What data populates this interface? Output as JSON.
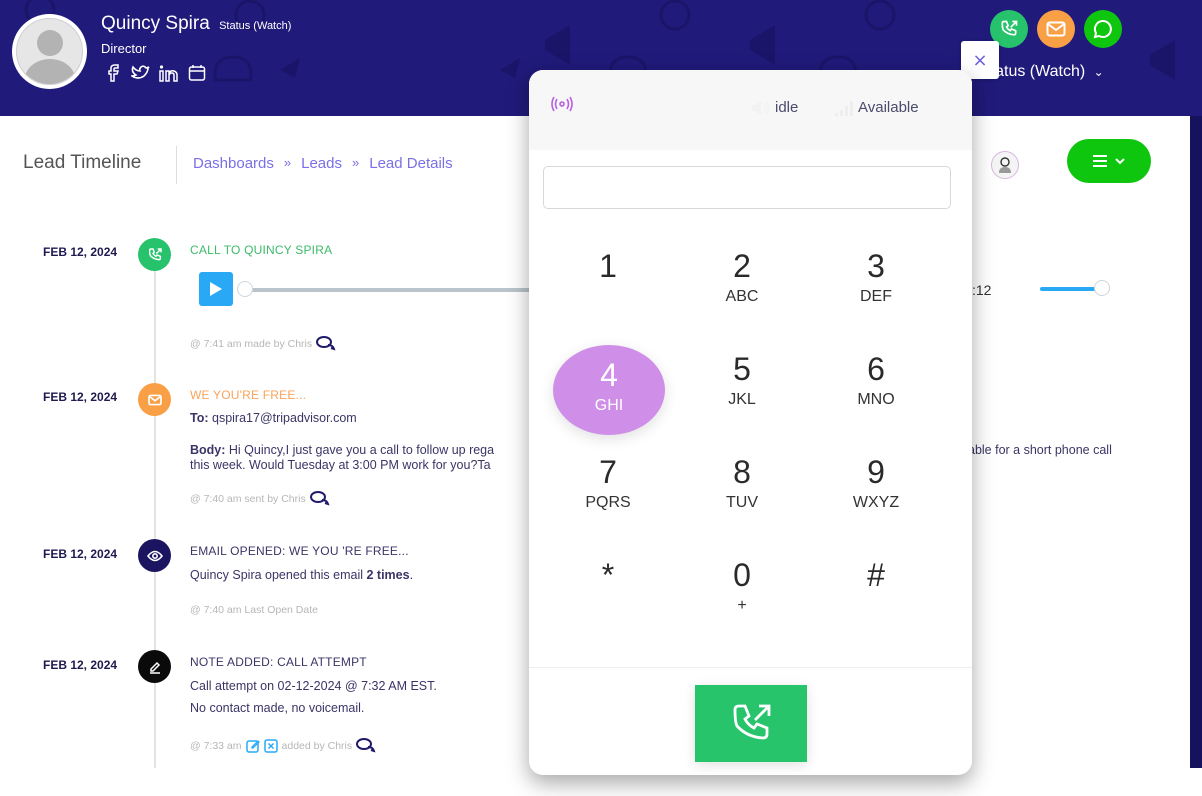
{
  "lead": {
    "name": "Quincy Spira",
    "status_small": "Status (Watch)",
    "title": "Director",
    "status_dropdown": "Status (Watch)"
  },
  "header_actions": {
    "icons": [
      "phone-outgoing-icon",
      "mail-icon",
      "chat-icon"
    ]
  },
  "page": {
    "title": "Lead Timeline",
    "breadcrumb": [
      "Dashboards",
      "Leads",
      "Lead Details"
    ],
    "breadcrumb_separator": "»"
  },
  "timeline": [
    {
      "date": "FEB 12, 2024",
      "type": "call",
      "title": "CALL TO QUINCY SPIRA",
      "title_color": "#3dbb6b",
      "audio": {
        "progress": 0,
        "time_end_partial": ":12",
        "volume": 1.0
      },
      "meta": "@ 7:41 am made by Chris"
    },
    {
      "date": "FEB 12, 2024",
      "type": "email",
      "title": "WE YOU'RE FREE...",
      "title_color": "#f9a35a",
      "to_label": "To:",
      "to_value": "qspira17@tripadvisor.com",
      "body_label": "Body:",
      "body_line1": "Hi Quincy,I just gave you a call to follow up rega",
      "body_line2": "this week. Would Tuesday at 3:00 PM work for you?Ta",
      "body_right": "able for a short phone call",
      "meta": "@ 7:40 am sent by Chris"
    },
    {
      "date": "FEB 12, 2024",
      "type": "email-opened",
      "title": "EMAIL OPENED: WE YOU 'RE FREE...",
      "title_color": "#3a3566",
      "text_prefix": "Quincy Spira opened this email",
      "count": "2 times",
      "text_suffix": ".",
      "meta": "@ 7:40 am Last Open Date"
    },
    {
      "date": "FEB 12, 2024",
      "type": "note",
      "title": "NOTE ADDED: CALL ATTEMPT",
      "title_color": "#3a3566",
      "line1": "Call attempt on 02-12-2024 @ 7:32 AM EST.",
      "line2": "No contact made, no voicemail.",
      "meta_time": "@ 7:33 am",
      "meta_by": "added by Chris"
    }
  ],
  "dialer": {
    "status_idle": "idle",
    "status_available": "Available",
    "input_value": "",
    "keys": [
      {
        "num": "1",
        "letters": ""
      },
      {
        "num": "2",
        "letters": "ABC"
      },
      {
        "num": "3",
        "letters": "DEF"
      },
      {
        "num": "4",
        "letters": "GHI",
        "active": true
      },
      {
        "num": "5",
        "letters": "JKL"
      },
      {
        "num": "6",
        "letters": "MNO"
      },
      {
        "num": "7",
        "letters": "PQRS"
      },
      {
        "num": "8",
        "letters": "TUV"
      },
      {
        "num": "9",
        "letters": "WXYZ"
      },
      {
        "num": "*",
        "letters": ""
      },
      {
        "num": "0",
        "letters": "+"
      },
      {
        "num": "#",
        "letters": ""
      }
    ],
    "close_label": "×"
  },
  "colors": {
    "banner": "#201a7a",
    "accent_purple": "#cf8fe8",
    "call_green": "#27c46c",
    "menu_green": "#0dc60d",
    "mail_orange": "#f99f45",
    "breadcrumb": "#7b6fe6"
  }
}
